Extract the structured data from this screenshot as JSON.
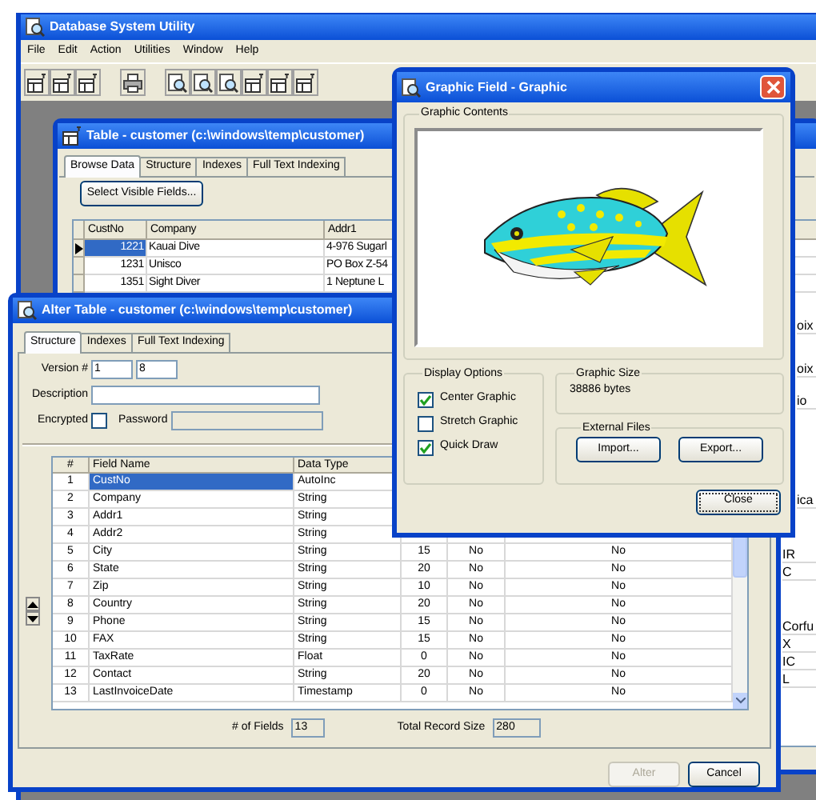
{
  "main_window": {
    "title": "Database System Utility",
    "menu": [
      "File",
      "Edit",
      "Action",
      "Utilities",
      "Window",
      "Help"
    ]
  },
  "table_window": {
    "title": "Table - customer (c:\\windows\\temp\\customer)",
    "tabs": [
      {
        "label": "Browse Data",
        "selected": true
      },
      {
        "label": "Structure",
        "selected": false
      },
      {
        "label": "Indexes",
        "selected": false
      },
      {
        "label": "Full Text Indexing",
        "selected": false
      }
    ],
    "button": "Select Visible Fields...",
    "columns": [
      "CustNo",
      "Company",
      "Addr1"
    ],
    "rows": [
      {
        "cells": [
          "1221",
          "Kauai Dive",
          "4-976 Sugarl"
        ],
        "selected": true
      },
      {
        "cells": [
          "1231",
          "Unisco",
          "PO Box Z-54"
        ],
        "selected": false
      },
      {
        "cells": [
          "1351",
          "Sight Diver",
          "1 Neptune L"
        ],
        "selected": false
      }
    ],
    "cut_off_cells": [
      "oix",
      "oix",
      "io",
      "ica",
      "IR",
      "C",
      "Corfu",
      "X",
      "IC",
      "L"
    ]
  },
  "alter_window": {
    "title": "Alter Table - customer (c:\\windows\\temp\\customer)",
    "tabs": [
      {
        "label": "Structure",
        "selected": true
      },
      {
        "label": "Indexes",
        "selected": false
      },
      {
        "label": "Full Text Indexing",
        "selected": false
      }
    ],
    "version_label": "Version #",
    "version_major": "1",
    "version_minor": "8",
    "description_label": "Description",
    "encrypted_label": "Encrypted",
    "encrypted": false,
    "password_label": "Password",
    "columns": [
      "#",
      "Field Name",
      "Data Type"
    ],
    "rows": [
      {
        "number": "1",
        "name": "CustNo",
        "type": "AutoInc",
        "selected": true
      },
      {
        "number": "2",
        "name": "Company",
        "type": "String",
        "selected": false
      },
      {
        "number": "3",
        "name": "Addr1",
        "type": "String",
        "selected": false
      },
      {
        "number": "4",
        "name": "Addr2",
        "type": "String",
        "selected": false
      },
      {
        "number": "5",
        "name": "City",
        "type": "String",
        "size": "15",
        "column_5": "No",
        "column_6": "No",
        "selected": false
      },
      {
        "number": "6",
        "name": "State",
        "type": "String",
        "size": "20",
        "column_5": "No",
        "column_6": "No",
        "selected": false
      },
      {
        "number": "7",
        "name": "Zip",
        "type": "String",
        "size": "10",
        "column_5": "No",
        "column_6": "No",
        "selected": false
      },
      {
        "number": "8",
        "name": "Country",
        "type": "String",
        "size": "20",
        "column_5": "No",
        "column_6": "No",
        "selected": false
      },
      {
        "number": "9",
        "name": "Phone",
        "type": "String",
        "size": "15",
        "column_5": "No",
        "column_6": "No",
        "selected": false
      },
      {
        "number": "10",
        "name": "FAX",
        "type": "String",
        "size": "15",
        "column_5": "No",
        "column_6": "No",
        "selected": false
      },
      {
        "number": "11",
        "name": "TaxRate",
        "type": "Float",
        "size": "0",
        "column_5": "No",
        "column_6": "No",
        "selected": false
      },
      {
        "number": "12",
        "name": "Contact",
        "type": "String",
        "size": "20",
        "column_5": "No",
        "column_6": "No",
        "selected": false
      },
      {
        "number": "13",
        "name": "LastInvoiceDate",
        "type": "Timestamp",
        "size": "0",
        "column_5": "No",
        "column_6": "No",
        "selected": false
      }
    ],
    "fields_label": "# of Fields",
    "fields_value": "13",
    "record_size_label": "Total Record Size",
    "record_size_value": "280",
    "buttons": [
      {
        "label": "Alter",
        "disabled": true
      },
      {
        "label": "Cancel",
        "disabled": false
      }
    ]
  },
  "graphic_dialog": {
    "title": "Graphic Field - Graphic",
    "contents_label": "Graphic Contents",
    "display_options": {
      "label": "Display Options",
      "options": [
        {
          "label": "Center Graphic",
          "checked": true
        },
        {
          "label": "Stretch Graphic",
          "checked": false
        },
        {
          "label": "Quick Draw",
          "checked": true
        }
      ]
    },
    "size_label": "Graphic Size",
    "size_value": "38886 bytes",
    "external_files": {
      "label": "External Files",
      "buttons": [
        "Import...",
        "Export..."
      ]
    },
    "close_button": "Close"
  }
}
